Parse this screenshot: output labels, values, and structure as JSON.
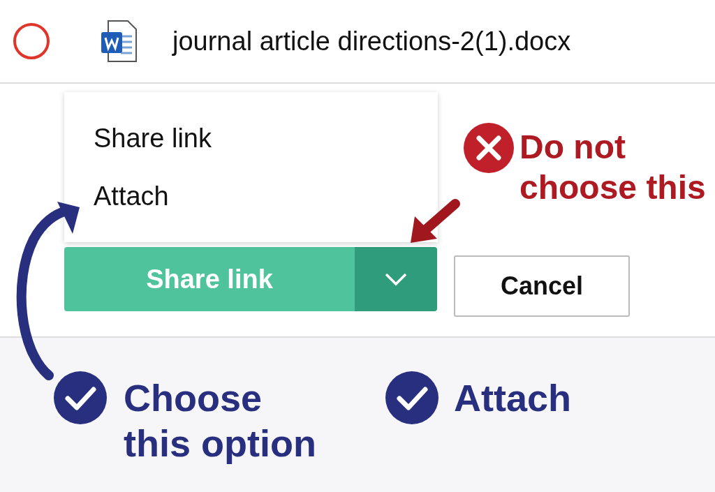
{
  "file": {
    "name": "journal article directions-2(1).docx",
    "selected": false
  },
  "menu": {
    "items": [
      {
        "label": "Share link"
      },
      {
        "label": "Attach"
      }
    ]
  },
  "split_button": {
    "label": "Share link"
  },
  "cancel_button": {
    "label": "Cancel"
  },
  "annotations": [
    {
      "kind": "warning",
      "text": "Do not choose this"
    },
    {
      "kind": "check",
      "text": "Choose this option"
    },
    {
      "kind": "check",
      "text": "Attach"
    }
  ]
}
